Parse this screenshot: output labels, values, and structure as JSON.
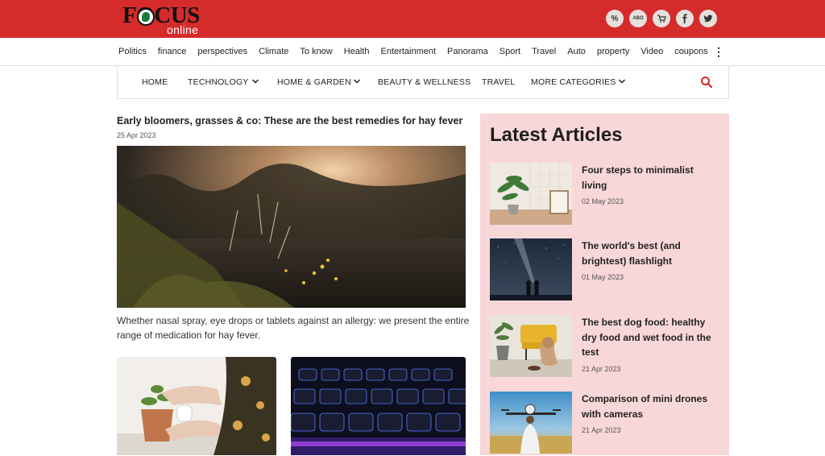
{
  "brand": {
    "logo_text": "FOCUS",
    "logo_sub": "online"
  },
  "top_icons": [
    {
      "icon": "percent-icon",
      "label": "%"
    },
    {
      "icon": "abo-icon",
      "label": "ABO"
    },
    {
      "icon": "cart-icon",
      "label": ""
    },
    {
      "icon": "facebook-icon",
      "label": ""
    },
    {
      "icon": "twitter-icon",
      "label": ""
    }
  ],
  "main_nav": [
    "Politics",
    "finance",
    "perspectives",
    "Climate",
    "To know",
    "Health",
    "Entertainment",
    "Panorama",
    "Sport",
    "Travel",
    "Auto",
    "property",
    "Video",
    "coupons"
  ],
  "sub_nav": {
    "home": "HOME",
    "technology": "TECHNOLOGY",
    "home_garden": "HOME & GARDEN",
    "beauty": "BEAUTY & WELLNESS",
    "travel": "TRAVEL",
    "more": "MORE CATEGORIES"
  },
  "main_article": {
    "headline": "Early bloomers, grasses & co: These are the best remedies for hay fever",
    "date": "25 Apr 2023",
    "teaser": "Whether nasal spray, eye drops or tablets against an allergy: we present the entire range of medication for hay fever."
  },
  "sidebar": {
    "heading": "Latest Articles",
    "articles": [
      {
        "title": "Four steps to minimalist living",
        "date": "02 May 2023"
      },
      {
        "title": "The world's best (and brightest) flashlight",
        "date": "01 May 2023"
      },
      {
        "title": "The best dog food: healthy dry food and wet food in the test",
        "date": "21 Apr 2023"
      },
      {
        "title": "Comparison of mini drones with cameras",
        "date": "21 Apr 2023"
      }
    ]
  },
  "colors": {
    "brand_red": "#d52b2b",
    "sidebar_bg": "#f8d7d9",
    "search_icon": "#d52b2b"
  }
}
